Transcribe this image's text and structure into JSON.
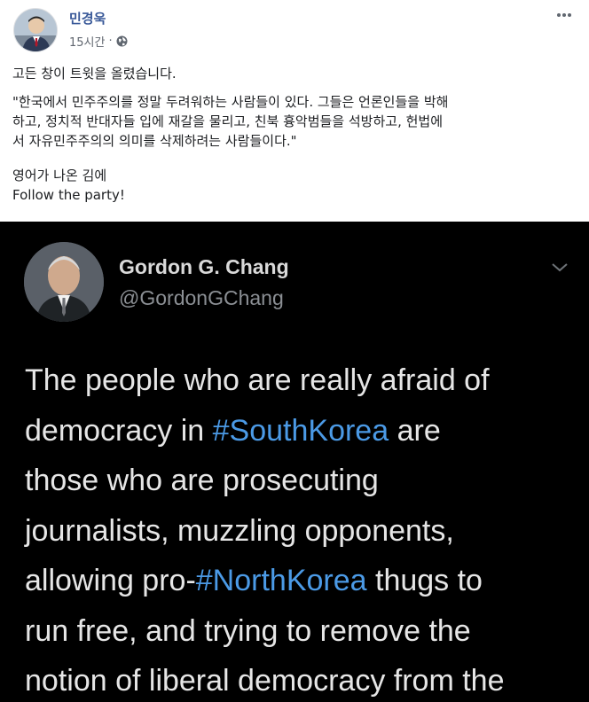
{
  "post": {
    "author": "민경욱",
    "timestamp": "15시간",
    "privacy_icon": "globe-icon",
    "more_icon": "ellipsis-icon",
    "paragraphs": [
      "고든 창이 트윗을 올렸습니다.",
      "\"한국에서 민주주의를 정말 두려워하는 사람들이 있다. 그들은 언론인들을 박해하고, 정치적 반대자들 입에 재갈을 물리고, 친북 흉악범들을 석방하고, 헌법에서 자유민주주의의 의미를 삭제하려는 사람들이다.\"",
      "영어가 나온 김에",
      "Follow the party!"
    ],
    "paragraph_lines": [
      "\"한국에서 민주주의를 정말 두려워하는 사람들이 있다. 그들은 언론인들을 박해",
      "하고, 정치적 반대자들 입에 재갈을 물리고, 친북 흉악범들을 석방하고, 헌법에",
      "서 자유민주주의의 의미를 삭제하려는 사람들이다.\""
    ]
  },
  "tweet": {
    "name": "Gordon G. Chang",
    "handle": "@GordonGChang",
    "menu_icon": "chevron-down-icon",
    "lines": [
      [
        {
          "t": "The people who are really afraid of"
        }
      ],
      [
        {
          "t": "democracy in "
        },
        {
          "t": "#SouthKorea",
          "tag": true
        },
        {
          "t": " are"
        }
      ],
      [
        {
          "t": "those who are prosecuting"
        }
      ],
      [
        {
          "t": "journalists, muzzling opponents,"
        }
      ],
      [
        {
          "t": "allowing pro-"
        },
        {
          "t": "#NorthKorea",
          "tag": true
        },
        {
          "t": " thugs to"
        }
      ],
      [
        {
          "t": "run free, and trying to remove the"
        }
      ],
      [
        {
          "t": "notion of liberal democracy from the"
        }
      ]
    ]
  },
  "colors": {
    "author_link": "#385898",
    "hashtag": "#4b9ae6",
    "tweet_bg": "#000000"
  }
}
